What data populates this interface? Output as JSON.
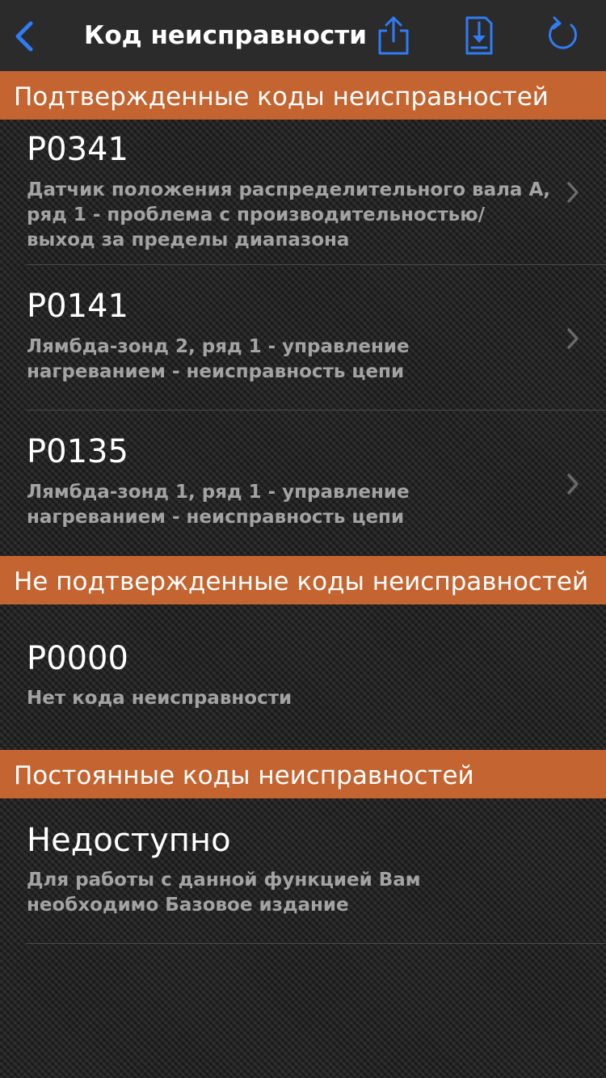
{
  "nav": {
    "title": "Код неисправности",
    "icons": {
      "back": "chevron-left-icon",
      "share": "share-icon",
      "save": "download-document-icon",
      "refresh": "refresh-icon"
    },
    "accent_color": "#2f7cf6"
  },
  "section_color": "#c46430",
  "sections": [
    {
      "title": "Подтвержденные коды неисправностей",
      "items": [
        {
          "code": "P0341",
          "description": "Датчик положения распределительного вала А, ряд 1 - проблема с производительностью/ выход за пределы диапазона"
        },
        {
          "code": "P0141",
          "description": "Лямбда-зонд 2, ряд 1 - управление нагреванием - неисправность цепи"
        },
        {
          "code": "P0135",
          "description": "Лямбда-зонд 1, ряд 1 - управление нагреванием - неисправность цепи"
        }
      ]
    },
    {
      "title": "Не подтвержденные коды неисправностей",
      "items": [
        {
          "code": "P0000",
          "description": "Нет кода неисправности"
        }
      ]
    },
    {
      "title": "Постоянные коды неисправностей",
      "items": [
        {
          "code": "Недоступно",
          "description": "Для работы с данной функцией Вам необходимо Базовое издание"
        }
      ]
    }
  ]
}
